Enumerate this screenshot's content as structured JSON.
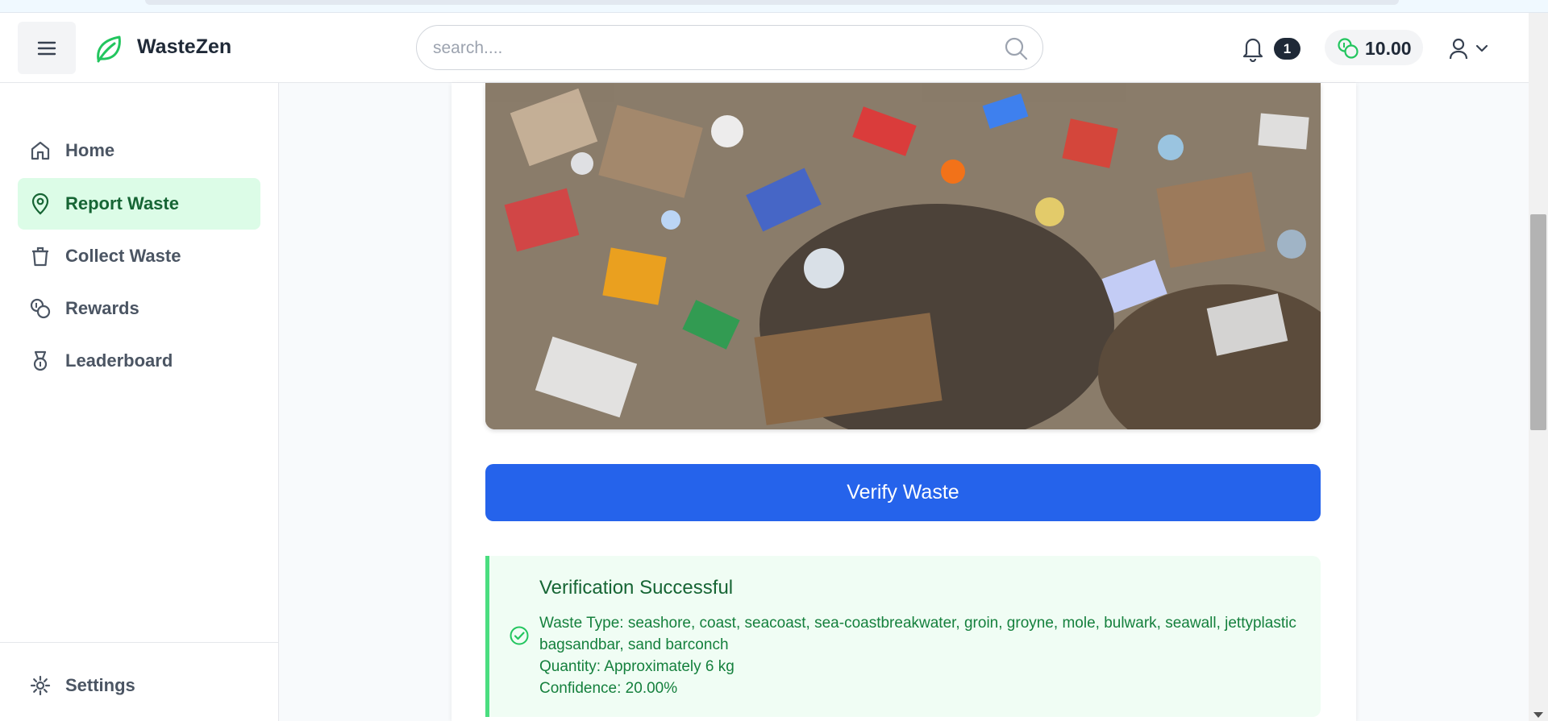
{
  "app": {
    "brand": "WasteZen",
    "brand_color": "#22c55e"
  },
  "header": {
    "search_placeholder": "search....",
    "notification_count": "1",
    "balance": "10.00"
  },
  "sidebar": {
    "items": [
      {
        "label": "Home",
        "icon": "home-icon",
        "active": false
      },
      {
        "label": "Report Waste",
        "icon": "map-pin-icon",
        "active": true
      },
      {
        "label": "Collect Waste",
        "icon": "trash-icon",
        "active": false
      },
      {
        "label": "Rewards",
        "icon": "coins-icon",
        "active": false
      },
      {
        "label": "Leaderboard",
        "icon": "medal-icon",
        "active": false
      }
    ],
    "settings_label": "Settings"
  },
  "main": {
    "verify_button": "Verify Waste",
    "result": {
      "title": "Verification Successful",
      "waste_type": "Waste Type: seashore, coast, seacoast, sea-coastbreakwater, groin, groyne, mole, bulwark, seawall, jettyplastic bagsandbar, sand barconch",
      "quantity": "Quantity: Approximately 6 kg",
      "confidence": "Confidence: 20.00%"
    }
  },
  "colors": {
    "primary_button": "#2563eb",
    "active_nav_bg": "#dcfce7",
    "active_nav_text": "#166534",
    "success_bg": "#f0fdf4",
    "success_border": "#4ade80"
  }
}
